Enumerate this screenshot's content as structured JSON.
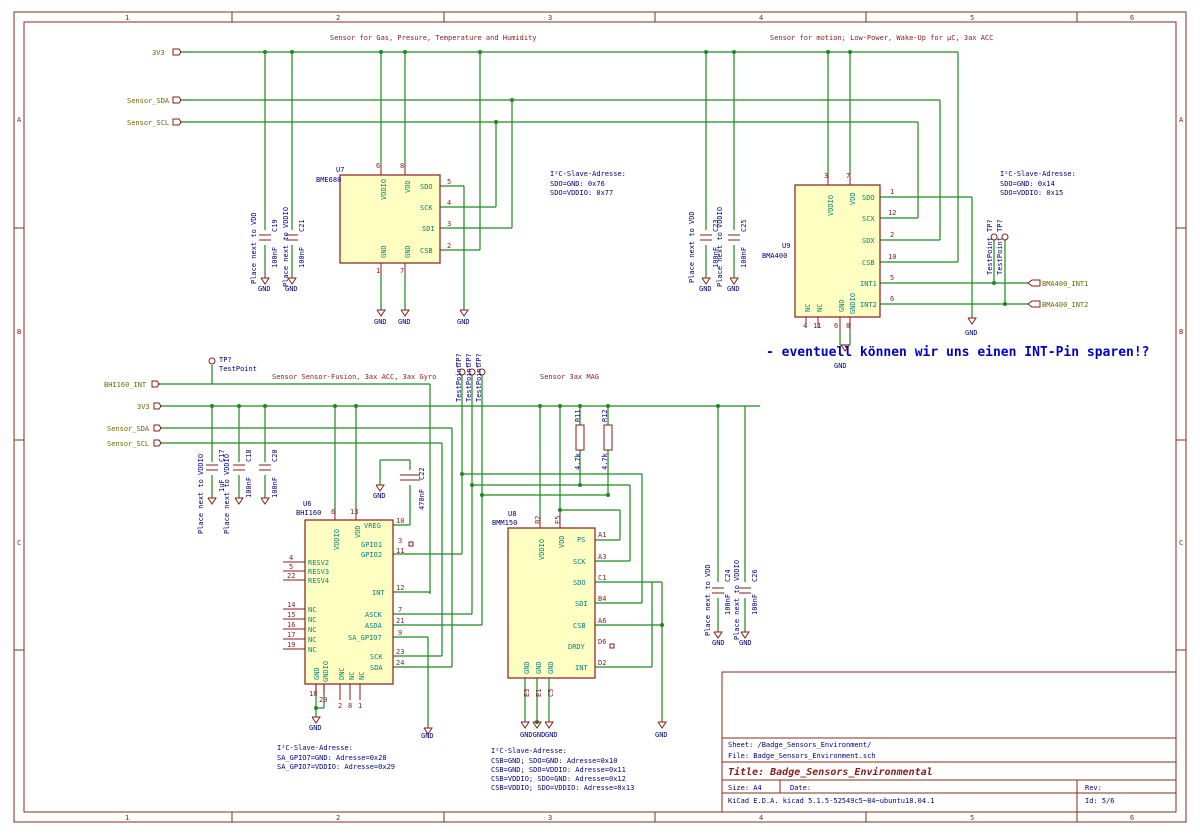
{
  "frame": {
    "cols": [
      "1",
      "2",
      "3",
      "4",
      "5",
      "6"
    ],
    "rows": [
      "A",
      "B",
      "C"
    ]
  },
  "titles": {
    "bme": "Sensor for Gas, Presure, Temperature and Humidity",
    "bma": "Sensor for motion; Low-Power, Wake-Up for µC, 3ax ACC",
    "bhi": "Sensor Sensor-Fusion, 3ax ACC, 3ax Gyro",
    "bmm": "Sensor 3ax MAG"
  },
  "nets": {
    "vdd": "3V3",
    "sda": "Sensor_SDA",
    "scl": "Sensor_SCL",
    "bhi_int": "BHI160_INT",
    "bma_int1": "BMA400_INT1",
    "bma_int2": "BMA400_INT2",
    "gnd": "GND"
  },
  "u7": {
    "ref": "U7",
    "value": "BME680",
    "pins_left": [
      "VDDIO",
      "VDD",
      "GND",
      "GND"
    ],
    "pins_right": [
      "SDO",
      "SCK",
      "SDI",
      "CSB"
    ],
    "nums_right": [
      "5",
      "4",
      "3",
      "2"
    ],
    "nums_top": [
      "6",
      "8"
    ],
    "nums_bot": [
      "1",
      "7"
    ]
  },
  "u9": {
    "ref": "U9",
    "value": "BMA400",
    "pins_top": [
      "VDDIO",
      "VDD"
    ],
    "pins_right": [
      "SDO",
      "SCX",
      "SDX",
      "CSB",
      "INT1",
      "INT2"
    ],
    "nums_right": [
      "1",
      "12",
      "2",
      "10",
      "5",
      "6"
    ],
    "pins_bot": [
      "NC",
      "NC",
      "GND",
      "GNDIO"
    ],
    "nums_top": [
      "3",
      "7"
    ],
    "nums_bot": [
      "4",
      "11",
      "6",
      "8"
    ]
  },
  "u6": {
    "ref": "U6",
    "value": "BHI160",
    "pins_top": [
      "VDDIO",
      "VDD"
    ],
    "nums_top": [
      "6",
      "13"
    ],
    "pins_left": [
      "RESV2",
      "RESV3",
      "RESV4",
      "NC",
      "NC",
      "NC",
      "NC",
      "NC"
    ],
    "nums_left": [
      "4",
      "5",
      "22",
      "14",
      "15",
      "16",
      "17",
      "19"
    ],
    "pins_right": [
      "VREG",
      "GPIO1",
      "GPIO2",
      "INT",
      "ASCK",
      "ASDA",
      "SA_GPIO7",
      "SCK",
      "SDA"
    ],
    "nums_right": [
      "10",
      "3",
      "11",
      "12",
      "7",
      "21",
      "9",
      "23",
      "24"
    ],
    "pins_bot": [
      "GND",
      "GNDIO",
      "DNC",
      "NC",
      "NC"
    ],
    "nums_bot": [
      "18",
      "20",
      "2",
      "8",
      "1"
    ]
  },
  "u8": {
    "ref": "U8",
    "value": "BMM150",
    "pins_top": [
      "VDDIO",
      "VDD"
    ],
    "nums_top": [
      "B2",
      "E5"
    ],
    "pins_right": [
      "PS",
      "SCK",
      "SDO",
      "SDI",
      "CSB",
      "DRDY",
      "INT"
    ],
    "nums_right": [
      "A1",
      "A3",
      "C1",
      "B4",
      "A6",
      "D6",
      "D2"
    ],
    "pins_bot": [
      "GND",
      "GND",
      "GND"
    ],
    "nums_bot": [
      "E3",
      "E1",
      "C5"
    ]
  },
  "caps": [
    {
      "ref": "C19",
      "value": "100nF",
      "note": "Place next to VDD"
    },
    {
      "ref": "C21",
      "value": "100nF",
      "note": "Place next to VDDIO"
    },
    {
      "ref": "C23",
      "value": "100nF",
      "note": "Place next to VDD"
    },
    {
      "ref": "C25",
      "value": "100nF",
      "note": "Place next to VDDIO"
    },
    {
      "ref": "C17",
      "value": "1uF",
      "note": "Place next to VDDIO"
    },
    {
      "ref": "C18",
      "value": "100nF",
      "note": "Place next to VDDIO"
    },
    {
      "ref": "C20",
      "value": "100nF",
      "note": ""
    },
    {
      "ref": "C22",
      "value": "470nF",
      "note": ""
    },
    {
      "ref": "C24",
      "value": "100nF",
      "note": "Place next to VDD"
    },
    {
      "ref": "C26",
      "value": "100nF",
      "note": "Place next to VDDIO"
    }
  ],
  "res": [
    {
      "ref": "R11",
      "value": "4.7k"
    },
    {
      "ref": "R12",
      "value": "4.7k"
    }
  ],
  "testpoints": {
    "tp_bhi": {
      "ref": "TP?",
      "value": "TestPoint"
    },
    "tp_bma1": {
      "ref": "TP?",
      "value": "TestPoint"
    },
    "tp_bma2": {
      "ref": "TP?",
      "value": "TestPoint"
    },
    "tp_asck": {
      "ref": "TP?",
      "value": "TestPoint"
    },
    "tp_asda": {
      "ref": "TP?",
      "value": "TestPoint"
    },
    "tp_gpio": {
      "ref": "TP?",
      "value": "TestPoint"
    }
  },
  "notes": {
    "bme_addr": [
      "I²C-Slave-Adresse:",
      "SDO=GND: 0x76",
      "SDO=VDDIO: 0x77"
    ],
    "bma_addr": [
      "I²C-Slave-Adresse:",
      "SDO=GND: 0x14",
      "SDO=VDDIO: 0x15"
    ],
    "bhi_addr": [
      "I²C-Slave-Adresse:",
      "SA_GPIO7=GND: Adresse=0x28",
      "SA_GPIO7=VDDIO: Adresse=0x29"
    ],
    "bmm_addr": [
      "I²C-Slave-Adresse:",
      "CSB=GND; SDO=GND: Adresse=0x10",
      "CSB=GND; SDO=VDDIO: Adresse=0x11",
      "CSB=VDDIO; SDO=GND: Adresse=0x12",
      "CSB=VDDIO; SDO=VDDIO: Adresse=0x13"
    ],
    "comment": "- eventuell können wir uns einen INT-Pin sparen!?",
    "gnd_merged": "GNDGND"
  },
  "title_block": {
    "sheet": "Sheet: /Badge_Sensors_Environment/",
    "file": "File: Badge_Sensors_Environment.sch",
    "title": "Title: Badge_Sensors_Environmental",
    "size": "Size: A4",
    "date": "Date:",
    "rev": "Rev:",
    "tool": "KiCad E.D.A.  kicad 5.1.5-52549c5~84~ubuntu18.04.1",
    "id": "Id: 5/6"
  },
  "colors": {
    "wire": "#1c8a1c",
    "component_fill": "#ffffc2",
    "component_stroke": "#8a1b1b",
    "pin_name": "#008484",
    "ref_text": "#0000b4",
    "net_label": "#6b6b00",
    "comment": "#0000c8"
  }
}
